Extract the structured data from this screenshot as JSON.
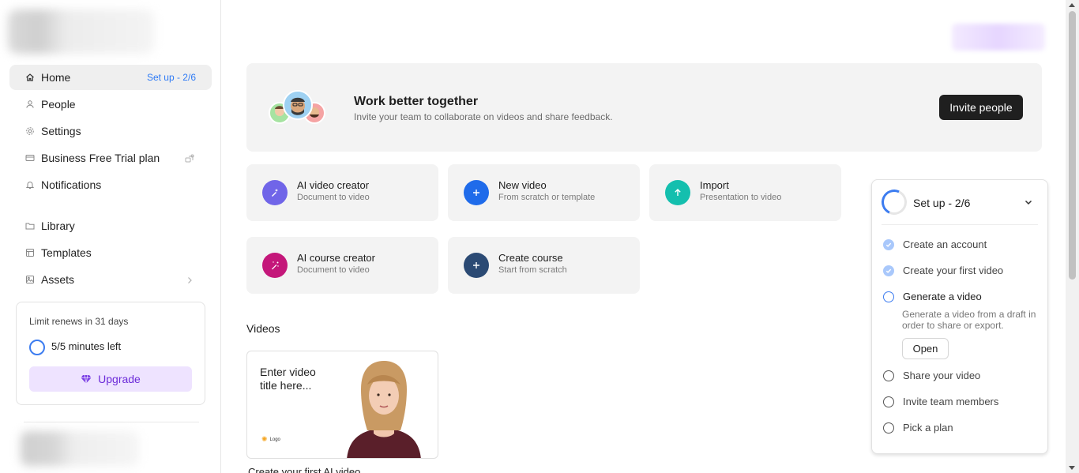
{
  "sidebar": {
    "nav": [
      {
        "label": "Home",
        "icon": "home-icon",
        "badge": "Set up - 2/6"
      },
      {
        "label": "People",
        "icon": "people-icon"
      },
      {
        "label": "Settings",
        "icon": "gear-icon"
      },
      {
        "label": "Business Free Trial plan",
        "icon": "credit-card-icon"
      },
      {
        "label": "Notifications",
        "icon": "bell-icon"
      },
      {
        "label": "Library",
        "icon": "folder-icon"
      },
      {
        "label": "Templates",
        "icon": "template-icon"
      },
      {
        "label": "Assets",
        "icon": "image-icon"
      }
    ],
    "limit": {
      "title": "Limit renews in 31 days",
      "minutes": "5/5 minutes left",
      "upgrade_label": "Upgrade"
    }
  },
  "banner": {
    "title": "Work better together",
    "subtitle": "Invite your team to collaborate on videos and share feedback.",
    "invite_label": "Invite people"
  },
  "actions": [
    {
      "title": "AI video creator",
      "subtitle": "Document to video",
      "color": "#7065e8",
      "icon": "wand-icon"
    },
    {
      "title": "New video",
      "subtitle": "From scratch or template",
      "color": "#1f6bea",
      "icon": "plus-icon"
    },
    {
      "title": "Import",
      "subtitle": "Presentation to video",
      "color": "#14bfae",
      "icon": "arrow-up-icon"
    },
    {
      "title": "AI course creator",
      "subtitle": "Document to video",
      "color": "#c4177a",
      "icon": "sparkle-wand-icon"
    },
    {
      "title": "Create course",
      "subtitle": "Start from scratch",
      "color": "#2b4a74",
      "icon": "plus-icon"
    }
  ],
  "videos": {
    "heading": "Videos",
    "card": {
      "title": "Enter video title here...",
      "logo": "Logo",
      "caption": "Create your first AI video"
    }
  },
  "setup": {
    "title": "Set up - 2/6",
    "progress": 0.333,
    "steps": [
      {
        "label": "Create an account",
        "state": "done"
      },
      {
        "label": "Create your first video",
        "state": "done"
      },
      {
        "label": "Generate a video",
        "state": "current"
      },
      {
        "label": "Share your video",
        "state": "todo"
      },
      {
        "label": "Invite team members",
        "state": "todo"
      },
      {
        "label": "Pick a plan",
        "state": "todo"
      }
    ],
    "current_desc": "Generate a video from a draft in order to share or export.",
    "open_label": "Open"
  },
  "colors": {
    "accent": "#3c7cf0",
    "upgrade_bg": "#eee3ff",
    "upgrade_text": "#6c2bd9"
  }
}
